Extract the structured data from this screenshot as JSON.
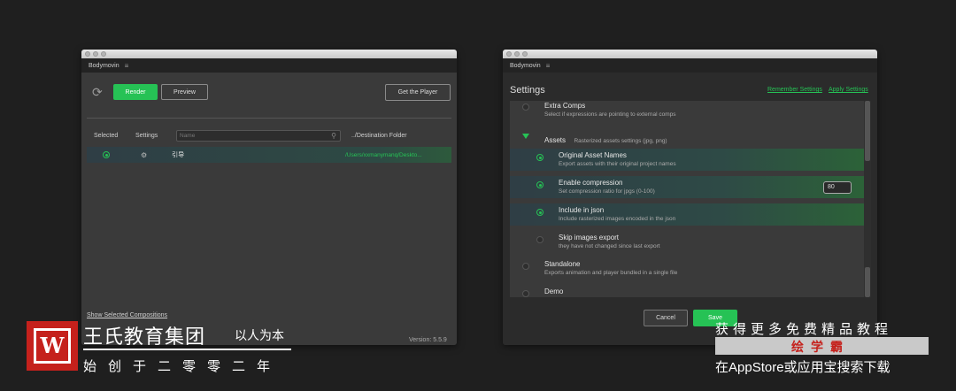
{
  "left_window": {
    "panel_title": "Bodymovin",
    "menu_icon": "≡",
    "buttons": {
      "render": "Render",
      "preview": "Preview",
      "get_player": "Get the Player"
    },
    "columns": {
      "selected": "Selected",
      "settings": "Settings",
      "search_placeholder": "Name",
      "destination": "../Destination Folder"
    },
    "composition": {
      "name": "引导",
      "path": "/Users/xxmanymanq/Deskto..."
    },
    "show_selected": "Show Selected Compositions",
    "version": "Version: 5.5.9"
  },
  "right_window": {
    "panel_title": "Bodymovin",
    "menu_icon": "≡",
    "title": "Settings",
    "remember": "Remember Settings",
    "apply": "Apply Settings",
    "items": [
      {
        "title": "Extra Comps",
        "desc": "Select if expressions are pointing to external comps"
      },
      {
        "title": "Assets",
        "desc": "Rasterized assets settings (jpg, png)"
      },
      {
        "title": "Original Asset Names",
        "desc": "Export assets with their original project names"
      },
      {
        "title": "Enable compression",
        "desc": "Set compression ratio for jpgs (0-100)",
        "value": "80"
      },
      {
        "title": "Include in json",
        "desc": "Include rasterized images encoded in the json"
      },
      {
        "title": "Skip images export",
        "desc": "they have not changed since last export"
      },
      {
        "title": "Standalone",
        "desc": "Exports animation and player bundled in a single file"
      },
      {
        "title": "Demo",
        "desc": ""
      }
    ],
    "cancel": "Cancel",
    "save": "Save"
  },
  "overlay": {
    "logo_letter": "W",
    "brand": "王氏教育集团",
    "slogan": "以人为本",
    "brand_sub": "始创于二零零二年",
    "promo_line1": "获得更多免费精品教程",
    "promo_bar": "绘学霸",
    "promo_line2": "在AppStore或应用宝搜索下载"
  },
  "colors": {
    "accent_green": "#26c255",
    "brand_red": "#c5211c"
  }
}
